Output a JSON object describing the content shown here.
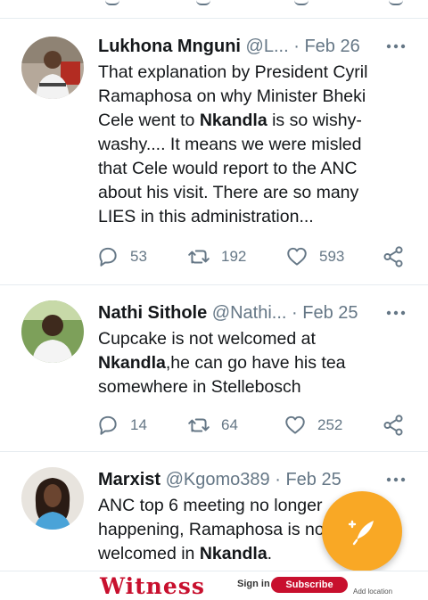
{
  "colors": {
    "text_primary": "#14171a",
    "text_secondary": "#657786",
    "divider": "#e6ecf0",
    "fab": "#f9a825"
  },
  "tweets": [
    {
      "name": "Lukhona Mnguni",
      "handle": "@L...",
      "dot": "·",
      "date": "Feb 26",
      "avatar": "user-photo",
      "body_parts": [
        "That explanation by President Cyril Ramaphosa on why Minister Bheki Cele went to ",
        "Nkandla",
        " is so wishy-washy.... It means we were misled that Cele would report to the ANC about his visit. There are so many LIES in this administration..."
      ],
      "replies": "53",
      "retweets": "192",
      "likes": "593"
    },
    {
      "name": "Nathi Sithole",
      "handle": "@Nathi...",
      "dot": "·",
      "date": "Feb 25",
      "avatar": "user-photo",
      "body_parts": [
        "Cupcake is not welcomed at ",
        "Nkandla",
        ",he can go have his tea somewhere in Stellebosch"
      ],
      "replies": "14",
      "retweets": "64",
      "likes": "252"
    },
    {
      "name": "Marxist",
      "handle": "@Kgomo389",
      "dot": "·",
      "date": "Feb 25",
      "avatar": "user-photo",
      "body_parts": [
        "ANC top 6 meeting no longer happening, Ramaphosa is not welcomed in ",
        "Nkandla",
        "."
      ]
    }
  ],
  "fab": {
    "icon": "compose-tweet-icon"
  },
  "ad": {
    "logo": "Witness",
    "sign_in": "Sign in",
    "subscribe": "Subscribe",
    "location": "Add location"
  }
}
